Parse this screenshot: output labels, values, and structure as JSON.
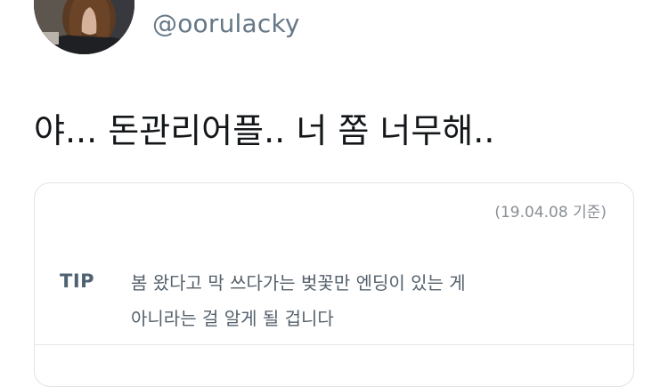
{
  "profile": {
    "handle": "@oorulacky",
    "avatar_icon": "profile-photo"
  },
  "tweet": {
    "text": "야... 돈관리어플.. 너 쫌 너무해.."
  },
  "card": {
    "date": "(19.04.08 기준)",
    "tip_label": "TIP",
    "tip_lines": [
      "봄 왔다고 막 쓰다가는 벚꽃만 엔딩이 있는 게",
      "아니라는 걸 알게 될 겁니다"
    ]
  }
}
